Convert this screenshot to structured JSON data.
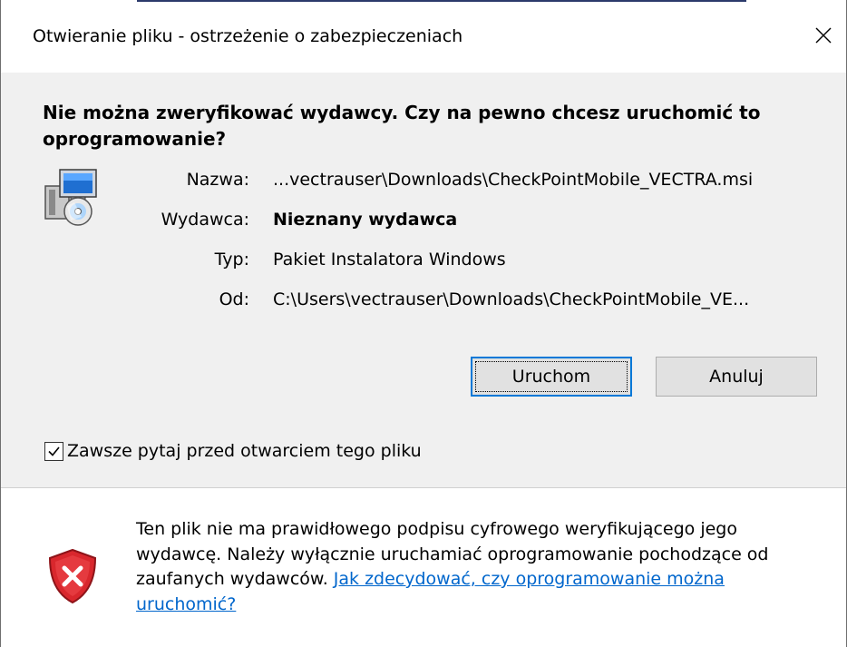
{
  "window": {
    "title": "Otwieranie pliku - ostrzeżenie o zabezpieczeniach",
    "close_glyph": "✕"
  },
  "heading": "Nie można zweryfikować wydawcy. Czy na pewno chcesz uruchomić to oprogramowanie?",
  "details": {
    "name_label": "Nazwa:",
    "name_value": "...vectrauser\\Downloads\\CheckPointMobile_VECTRA.msi",
    "publisher_label": "Wydawca:",
    "publisher_value": "Nieznany wydawca",
    "type_label": "Typ:",
    "type_value": "Pakiet Instalatora Windows",
    "from_label": "Od:",
    "from_value": "C:\\Users\\vectrauser\\Downloads\\CheckPointMobile_VE..."
  },
  "buttons": {
    "run": "Uruchom",
    "cancel": "Anuluj"
  },
  "checkbox": {
    "label": "Zawsze pytaj przed otwarciem tego pliku",
    "checked": true
  },
  "footer": {
    "text": "Ten plik nie ma prawidłowego podpisu cyfrowego weryfikującego jego wydawcę. Należy wyłącznie uruchamiać oprogramowanie pochodzące od zaufanych wydawców. ",
    "link": "Jak zdecydować, czy oprogramowanie można uruchomić?"
  },
  "icons": {
    "app": "installer-package-icon",
    "warning": "security-shield-error-icon"
  },
  "colors": {
    "accent": "#0078d7",
    "link": "#0066cc",
    "shield_red": "#d9272d"
  }
}
